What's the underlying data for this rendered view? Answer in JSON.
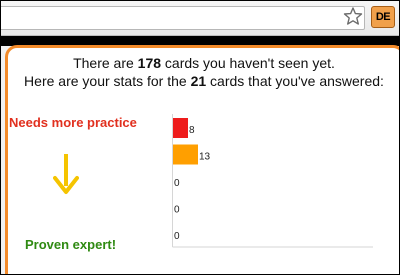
{
  "browser": {
    "extension_badge": "DE"
  },
  "popup": {
    "intro_line1": {
      "before": "There are ",
      "count": "178",
      "after": " cards you haven't seen yet."
    },
    "intro_line2": {
      "before": "Here are your stats for the ",
      "count": "21",
      "after": " cards that you've answered:"
    },
    "label_top": "Needs more practice",
    "label_bottom": "Proven expert!"
  },
  "colors": {
    "accent_border": "#f38b2a",
    "practice_text": "#e1301f",
    "expert_text": "#2f8a12",
    "arrow": "#f5c400"
  },
  "chart_data": {
    "type": "bar",
    "orientation": "horizontal",
    "categories": [
      "",
      "",
      "",
      "",
      ""
    ],
    "values": [
      8,
      13,
      0,
      0,
      0
    ],
    "bar_colors": [
      "#ee1c1c",
      "#ff9f00",
      "#f5c400",
      "#8cc63f",
      "#2f8a12"
    ],
    "xlim": [
      0,
      13
    ],
    "grid": false,
    "data_labels": true
  }
}
